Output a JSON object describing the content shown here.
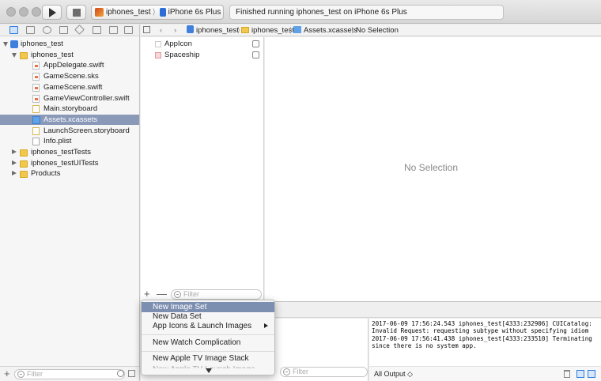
{
  "scheme": {
    "target": "iphones_test",
    "device": "iPhone 6s Plus"
  },
  "status": "Finished running iphones_test on iPhone 6s Plus",
  "navigator": {
    "tree": [
      {
        "label": "iphones_test",
        "type": "project",
        "indent": 0,
        "disclosure": "open"
      },
      {
        "label": "iphones_test",
        "type": "folder",
        "indent": 1,
        "disclosure": "open"
      },
      {
        "label": "AppDelegate.swift",
        "type": "file",
        "indent": 2
      },
      {
        "label": "GameScene.sks",
        "type": "file",
        "indent": 2
      },
      {
        "label": "GameScene.swift",
        "type": "file",
        "indent": 2
      },
      {
        "label": "GameViewController.swift",
        "type": "file",
        "indent": 2
      },
      {
        "label": "Main.storyboard",
        "type": "storyboard",
        "indent": 2
      },
      {
        "label": "Assets.xcassets",
        "type": "assets",
        "indent": 2,
        "selected": true
      },
      {
        "label": "LaunchScreen.storyboard",
        "type": "storyboard",
        "indent": 2
      },
      {
        "label": "Info.plist",
        "type": "plist",
        "indent": 2
      },
      {
        "label": "iphones_testTests",
        "type": "folder",
        "indent": 1,
        "disclosure": "closed"
      },
      {
        "label": "iphones_testUITests",
        "type": "folder",
        "indent": 1,
        "disclosure": "closed"
      },
      {
        "label": "Products",
        "type": "folder",
        "indent": 1,
        "disclosure": "closed"
      }
    ],
    "filter_placeholder": "Filter"
  },
  "jumpbar": {
    "project": "iphones_test",
    "folder": "iphones_test",
    "file": "Assets.xcassets",
    "selection": "No Selection"
  },
  "assets": {
    "items": [
      {
        "label": "AppIcon"
      },
      {
        "label": "Spaceship"
      }
    ],
    "filter_placeholder": "Filter",
    "plus": "+",
    "minus": "—"
  },
  "editor": {
    "empty_text": "No Selection"
  },
  "menu": {
    "items": [
      {
        "label": "New Image Set",
        "highlighted": true
      },
      {
        "label": "New Data Set"
      },
      {
        "label": "App Icons & Launch Images",
        "submenu": true
      },
      {
        "label": "New Watch Complication"
      },
      {
        "label": "New Apple TV Image Stack"
      }
    ]
  },
  "variables": {
    "filter_placeholder": "Filter"
  },
  "console": {
    "text": "2017-06-09 17:56:24.543 iphones_test[4333:232906] CUICatalog:\nInvalid Request: requesting subtype without specifying idiom\n2017-06-09 17:56:41.438 iphones_test[4333:233510] Terminating\nsince there is no system app.",
    "output_selector": "All Output ◇"
  },
  "colors": {
    "accent": "#2f7bdc",
    "selection": "#8a99b8",
    "menu_highlight": "#7d8fb1"
  }
}
